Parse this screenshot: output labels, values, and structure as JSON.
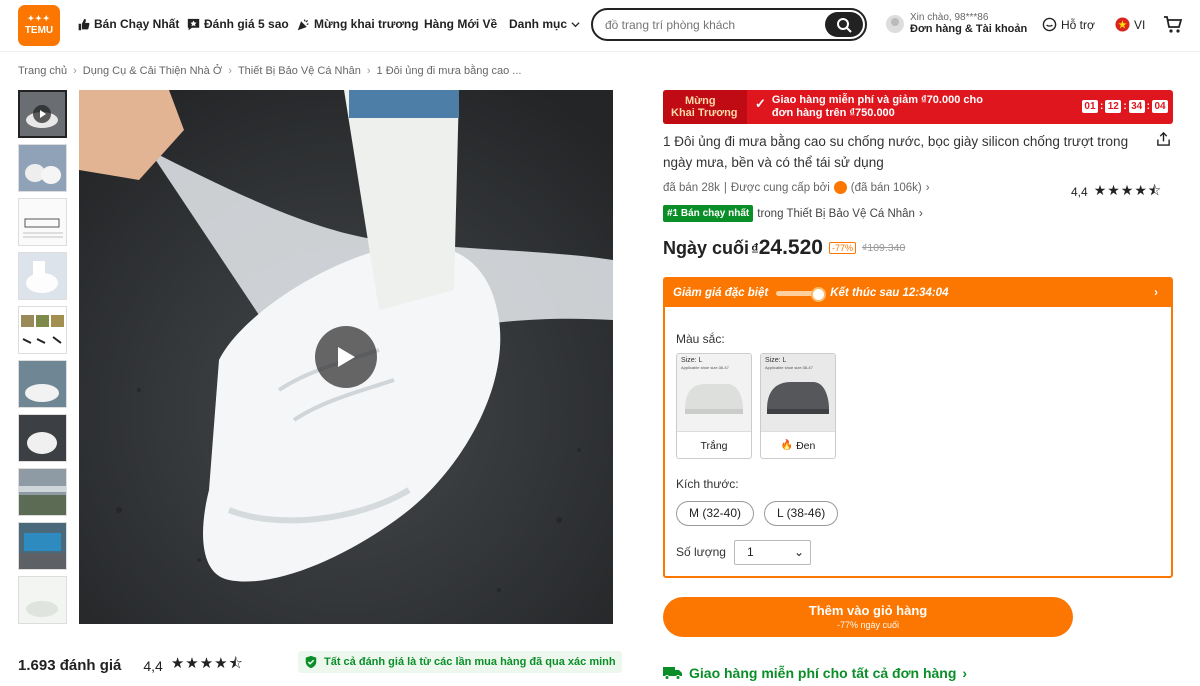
{
  "header": {
    "logo_top": "",
    "logo_text": "TEMU",
    "nav": [
      {
        "label": "Bán Chạy Nhất",
        "icon": "thumbs-up-icon"
      },
      {
        "label": "Đánh giá 5 sao",
        "icon": "star-chat-icon"
      },
      {
        "label": "Mừng khai trương",
        "icon": "party-popper-icon"
      },
      {
        "label": "Hàng Mới Về",
        "icon": ""
      },
      {
        "label": "Danh mục",
        "icon": "chevron-down-icon"
      }
    ],
    "search_placeholder": "đồ trang trí phòng khách",
    "account_greeting": "Xin chào, 98***86",
    "account_label": "Đơn hàng & Tài khoản",
    "support_label": "Hỗ trợ",
    "language": "VI"
  },
  "breadcrumb": [
    "Trang chủ",
    "Dụng Cụ & Cải Thiện Nhà Ở",
    "Thiết Bị Bảo Vệ Cá Nhân",
    "1 Đôi ủng đi mưa bằng cao ..."
  ],
  "gallery": {
    "thumb_count": 10
  },
  "reviews": {
    "count_text": "1.693 đánh giá",
    "rating": "4,4",
    "stars": "★★★★⯪",
    "verified_text": "Tất cả đánh giá là từ các lần mua hàng đã qua xác minh"
  },
  "promo": {
    "tag_line1": "Mừng",
    "tag_line2": "Khai Trương",
    "message_line1": "Giao hàng miễn phí và giảm ₫70.000 cho",
    "message_line2": "đơn hàng trên ₫750.000",
    "timer": [
      "01",
      "12",
      "34",
      "04"
    ]
  },
  "product": {
    "title": "1 Đôi ủng đi mưa bằng cao su chống nước, bọc giày silicon chống trượt trong ngày mưa, bền và có thể tái sử dụng",
    "sold": "đã bán 28k",
    "supplied_by": "Được cung cấp bởi",
    "seller_sold": "(đã bán 106k)",
    "rating": "4,4",
    "stars": "★★★★⯪",
    "best_badge": "#1 Bán chạy nhất",
    "best_category": "trong Thiết Bị Bảo Vệ Cá Nhân",
    "price_label": "Ngày cuối",
    "currency": "₫",
    "price": "24.520",
    "discount": "-77%",
    "old_price": "₫109.340"
  },
  "deal": {
    "title": "Giảm giá đặc biệt",
    "ends_text": "Kết thúc sau 12:34:04",
    "progress": 0.85
  },
  "options": {
    "color_label": "Màu sắc:",
    "colors": [
      {
        "name": "Trắng",
        "swatch": "#d9dcd8",
        "caption_icon": ""
      },
      {
        "name": "Đen",
        "swatch": "#55575a",
        "caption_icon": "flame-icon"
      }
    ],
    "swatch_size_text": "Size: L",
    "swatch_fit_text": "Applicable shoe size:38-47",
    "size_label": "Kích thước:",
    "sizes": [
      "M (32-40)",
      "L (38-46)"
    ],
    "qty_label": "Số lượng",
    "qty_value": "1"
  },
  "cart": {
    "button_label": "Thêm vào giỏ hàng",
    "button_sub": "-77% ngày cuối"
  },
  "shipping": {
    "text": "Giao hàng miễn phí cho tất cả đơn hàng"
  },
  "colors": {
    "brand": "#fb7701",
    "promo_red": "#e0161e",
    "verified_green": "#0a8f28"
  }
}
